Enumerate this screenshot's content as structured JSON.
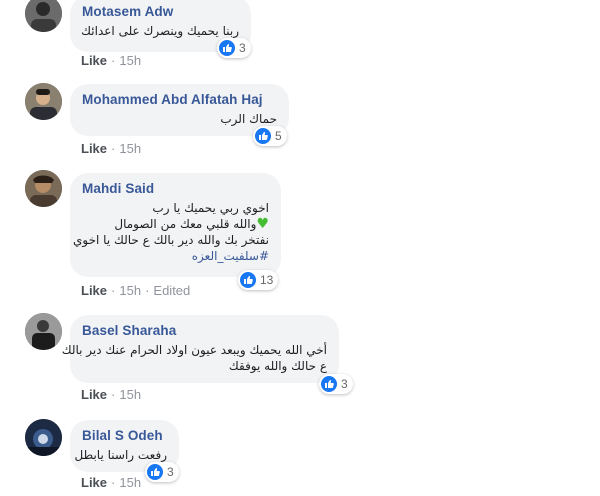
{
  "comments": [
    {
      "author": "Motasem Adw",
      "lines": [
        "ربنا يحميك وينصرك على اعدائك"
      ],
      "reactions": "3",
      "like_label": "Like",
      "time": "15h"
    },
    {
      "author": "Mohammed Abd Alfatah Haj",
      "lines": [
        "حماك الرب"
      ],
      "reactions": "5",
      "like_label": "Like",
      "time": "15h"
    },
    {
      "author": "Mahdi Said",
      "lines": [
        "اخوي ربي يحميك يا رب",
        "والله قلبي معك من الصومال",
        "نفتخر بك والله دير بالك ع حالك يا اخوي"
      ],
      "hashtag": "#سلفيت_العزه",
      "reactions": "13",
      "like_label": "Like",
      "time": "15h",
      "edited": "Edited"
    },
    {
      "author": "Basel Sharaha",
      "lines": [
        "أخي الله يحميك ويبعد عيون اولاد الحرام عنك دير بالك",
        "ع حالك والله يوفقك"
      ],
      "reactions": "3",
      "like_label": "Like",
      "time": "15h"
    },
    {
      "author": "Bilal S Odeh",
      "lines": [
        "رفعت راسنا يابطل"
      ],
      "reactions": "3",
      "like_label": "Like",
      "time": "15h"
    }
  ],
  "colors": {
    "link": "#385898",
    "bubble": "#f2f3f5",
    "like_blue": "#1877f2",
    "meta": "#90949c"
  }
}
